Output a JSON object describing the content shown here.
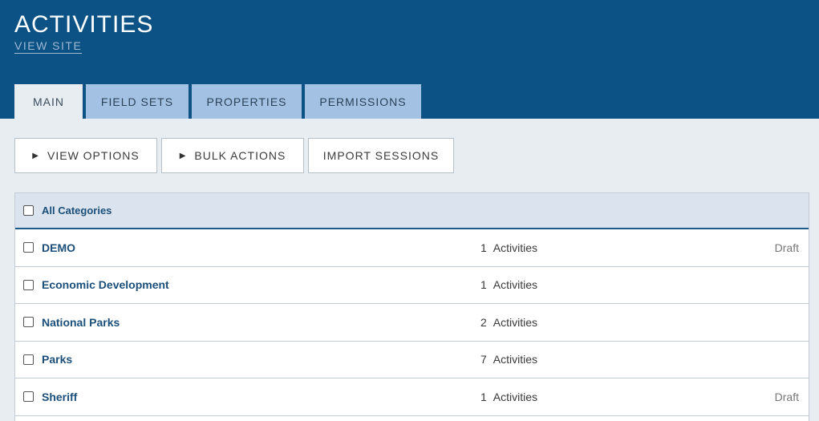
{
  "header": {
    "title": "ACTIVITIES",
    "view_site": "VIEW SITE"
  },
  "tabs": [
    {
      "label": "MAIN",
      "active": true
    },
    {
      "label": "FIELD SETS",
      "active": false
    },
    {
      "label": "PROPERTIES",
      "active": false
    },
    {
      "label": "PERMISSIONS",
      "active": false
    }
  ],
  "actions": {
    "view_options": "VIEW OPTIONS",
    "bulk_actions": "BULK ACTIONS",
    "import_sessions": "IMPORT SESSIONS",
    "triangle_glyph": "▶"
  },
  "table": {
    "header_label": "All Categories",
    "rows": [
      {
        "name": "DEMO",
        "count": "1",
        "unit": "Activities",
        "status": "Draft"
      },
      {
        "name": "Economic Development",
        "count": "1",
        "unit": "Activities",
        "status": ""
      },
      {
        "name": "National Parks",
        "count": "2",
        "unit": "Activities",
        "status": ""
      },
      {
        "name": "Parks",
        "count": "7",
        "unit": "Activities",
        "status": ""
      },
      {
        "name": "Sheriff",
        "count": "1",
        "unit": "Activities",
        "status": "Draft"
      }
    ]
  },
  "colors": {
    "header_bg": "#0c5285",
    "tab_bg": "#a3c1e2",
    "page_bg": "#e8edf1",
    "link": "#1b4f7a"
  }
}
